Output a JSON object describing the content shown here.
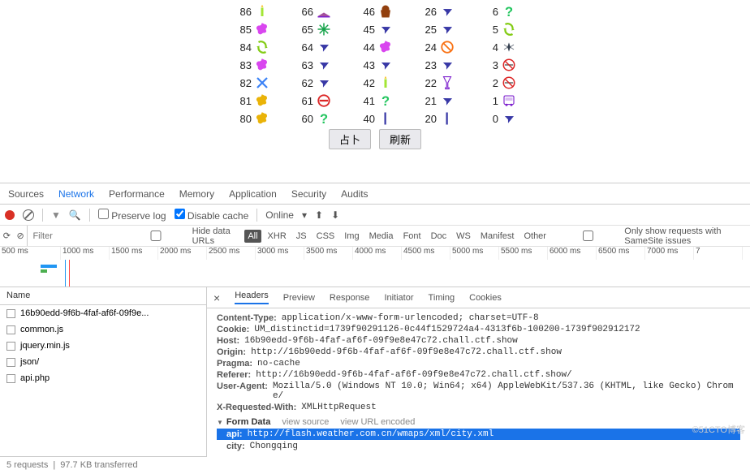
{
  "grid": {
    "cols": [
      [
        {
          "n": "86",
          "i": "candle"
        },
        {
          "n": "85",
          "i": "splat-p"
        },
        {
          "n": "84",
          "i": "cycle"
        },
        {
          "n": "83",
          "i": "splat-p"
        },
        {
          "n": "82",
          "i": "x-b"
        },
        {
          "n": "81",
          "i": "splat-y"
        },
        {
          "n": "80",
          "i": "splat-y"
        }
      ],
      [
        {
          "n": "66",
          "i": "cake"
        },
        {
          "n": "65",
          "i": "star-g"
        },
        {
          "n": "64",
          "i": "plane"
        },
        {
          "n": "63",
          "i": "plane"
        },
        {
          "n": "62",
          "i": "plane"
        },
        {
          "n": "61",
          "i": "noentry"
        },
        {
          "n": "60",
          "i": "q"
        }
      ],
      [
        {
          "n": "46",
          "i": "bag"
        },
        {
          "n": "45",
          "i": "plane"
        },
        {
          "n": "44",
          "i": "splat-p"
        },
        {
          "n": "43",
          "i": "plane"
        },
        {
          "n": "42",
          "i": "candle"
        },
        {
          "n": "41",
          "i": "q"
        },
        {
          "n": "40",
          "i": "line"
        }
      ],
      [
        {
          "n": "26",
          "i": "plane"
        },
        {
          "n": "25",
          "i": "plane"
        },
        {
          "n": "24",
          "i": "nosign"
        },
        {
          "n": "23",
          "i": "plane"
        },
        {
          "n": "22",
          "i": "glass"
        },
        {
          "n": "21",
          "i": "plane"
        },
        {
          "n": "20",
          "i": "line"
        }
      ],
      [
        {
          "n": "6",
          "i": "q"
        },
        {
          "n": "5",
          "i": "cycle"
        },
        {
          "n": "4",
          "i": "mosq"
        },
        {
          "n": "3",
          "i": "nosmoking"
        },
        {
          "n": "2",
          "i": "nosmoking"
        },
        {
          "n": "1",
          "i": "bus"
        },
        {
          "n": "0",
          "i": "plane"
        }
      ]
    ]
  },
  "buttons": {
    "left": "占卜",
    "right": "刷新"
  },
  "devtabs": [
    "Sources",
    "Network",
    "Performance",
    "Memory",
    "Application",
    "Security",
    "Audits"
  ],
  "toolbar": {
    "preserve": "Preserve log",
    "disable": "Disable cache",
    "online": "Online"
  },
  "filter": {
    "placeholder": "Filter",
    "hide": "Hide data URLs",
    "types": [
      "All",
      "XHR",
      "JS",
      "CSS",
      "Img",
      "Media",
      "Font",
      "Doc",
      "WS",
      "Manifest",
      "Other"
    ],
    "samesite": "Only show requests with SameSite issues"
  },
  "timeline": [
    "500 ms",
    "1000 ms",
    "1500 ms",
    "2000 ms",
    "2500 ms",
    "3000 ms",
    "3500 ms",
    "4000 ms",
    "4500 ms",
    "5000 ms",
    "5500 ms",
    "6000 ms",
    "6500 ms",
    "7000 ms",
    "7"
  ],
  "requests": {
    "header": "Name",
    "items": [
      "16b90edd-9f6b-4faf-af6f-09f9e...",
      "common.js",
      "jquery.min.js",
      "json/",
      "api.php"
    ]
  },
  "footer": {
    "reqs": "5 requests",
    "size": "97.7 KB transferred"
  },
  "details": {
    "tabs": [
      "Headers",
      "Preview",
      "Response",
      "Initiator",
      "Timing",
      "Cookies"
    ],
    "headers": [
      {
        "k": "Content-Type:",
        "v": "application/x-www-form-urlencoded; charset=UTF-8"
      },
      {
        "k": "Cookie:",
        "v": "UM_distinctid=1739f90291126-0c44f1529724a4-4313f6b-100200-1739f902912172"
      },
      {
        "k": "Host:",
        "v": "16b90edd-9f6b-4faf-af6f-09f9e8e47c72.chall.ctf.show"
      },
      {
        "k": "Origin:",
        "v": "http://16b90edd-9f6b-4faf-af6f-09f9e8e47c72.chall.ctf.show"
      },
      {
        "k": "Pragma:",
        "v": "no-cache"
      },
      {
        "k": "Referer:",
        "v": "http://16b90edd-9f6b-4faf-af6f-09f9e8e47c72.chall.ctf.show/"
      },
      {
        "k": "User-Agent:",
        "v": "Mozilla/5.0 (Windows NT 10.0; Win64; x64) AppleWebKit/537.36 (KHTML, like Gecko) Chrome/"
      },
      {
        "k": "X-Requested-With:",
        "v": "XMLHttpRequest"
      }
    ],
    "formdata": {
      "title": "Form Data",
      "links": [
        "view source",
        "view URL encoded"
      ],
      "rows": [
        {
          "k": "api:",
          "v": "http://flash.weather.com.cn/wmaps/xml/city.xml",
          "hl": true
        },
        {
          "k": "city:",
          "v": "Chongqing"
        }
      ]
    }
  },
  "watermark": "©51CTO博客"
}
